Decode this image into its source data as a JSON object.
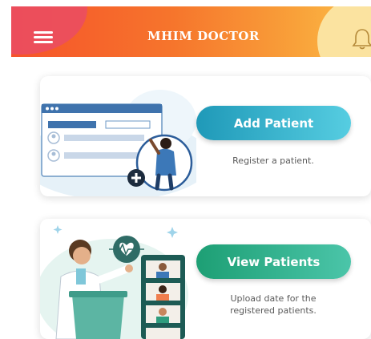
{
  "header": {
    "title": "MHIM DOCTOR",
    "menu_icon": "hamburger-menu-icon",
    "bell_icon": "notification-bell-icon",
    "colors": {
      "gradient_start": "#f6532a",
      "gradient_end": "#fbbf49"
    }
  },
  "cards": [
    {
      "button_label": "Add Patient",
      "caption": "Register a patient.",
      "illustration": "add-patient-illustration",
      "accent": "#1f99b8"
    },
    {
      "button_label": "View Patients",
      "caption_line1": "Upload date for the",
      "caption_line2": "registered patients.",
      "illustration": "doctor-consultation-illustration",
      "accent": "#1d9f74"
    }
  ]
}
